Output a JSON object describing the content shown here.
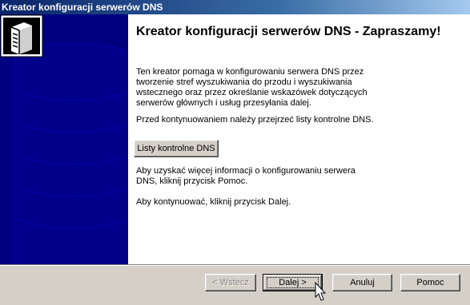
{
  "window": {
    "title": "Kreator konfiguracji serwerów DNS"
  },
  "side_icon": "dns-server-icon",
  "content": {
    "heading": "Kreator konfiguracji serwerów DNS - Zapraszamy!",
    "intro": "Ten kreator pomaga w konfigurowaniu serwera DNS przez tworzenie stref wyszukiwania do przodu i wyszukiwania wstecznego oraz przez określanie wskazówek dotyczących serwerów głównych i usług przesyłania dalej.",
    "checklist_note": "Przed kontynuowaniem należy przejrzeć listy kontrolne DNS.",
    "checklist_button": "Listy kontrolne DNS",
    "help_info": "Aby uzyskać więcej informacji o konfigurowaniu serwera DNS, kliknij przycisk Pomoc.",
    "continue_info": "Aby kontynuować, kliknij przycisk Dalej."
  },
  "buttons": {
    "back": "< Wstecz",
    "next": "Dalej >",
    "cancel": "Anuluj",
    "help": "Pomoc"
  },
  "colors": {
    "side_panel": "#000080",
    "title_bar": "#0a246a",
    "dialog": "#d4d0c8"
  }
}
